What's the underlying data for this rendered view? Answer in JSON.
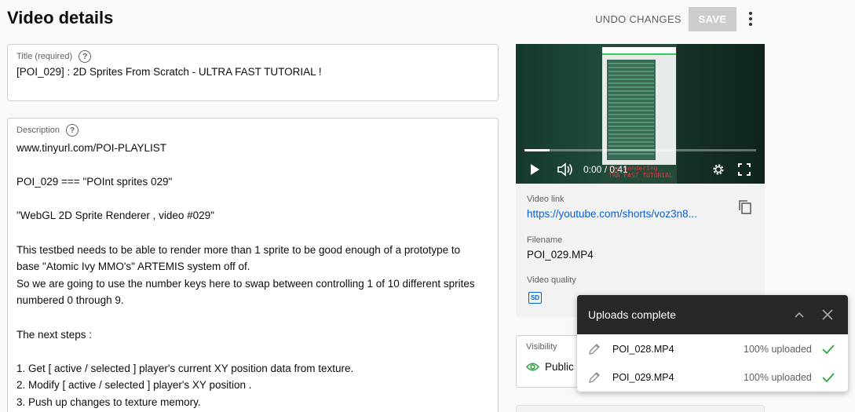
{
  "header": {
    "title": "Video details",
    "undo_label": "UNDO CHANGES",
    "save_label": "SAVE",
    "more_icon": "more-vert-icon"
  },
  "title_field": {
    "label": "Title (required)",
    "value": "[POI_029] : 2D Sprites From Scratch - ULTRA FAST TUTORIAL !"
  },
  "description_field": {
    "label": "Description",
    "lines": [
      "www.tinyurl.com/POI-PLAYLIST",
      "",
      "POI_029 === \"POInt sprites 029\"",
      "",
      "\"WebGL 2D Sprite Renderer , video #029\"",
      "",
      "This testbed needs to be able to render more than 1 sprite to be good enough of a prototype to",
      "base \"Atomic Ivy MMO's\" ARTEMIS system off of.",
      "So we are going to use the number keys here to swap between controlling 1 of 10 different sprites",
      "numbered 0 through 9.",
      "",
      "The next steps :",
      "",
      "1. Get [ active / selected ] player's current XY position data from texture.",
      "2. Modify [ active / selected ] player's XY position .",
      "3. Push up changes to texture memory."
    ]
  },
  "player": {
    "time": "0:00 / 0:41",
    "progress": 0.11,
    "overlay_text": "ite Rendering",
    "overlay_text2": "TRA FAST TUTORIAL"
  },
  "video_info": {
    "link_label": "Video link",
    "link": "https://youtube.com/shorts/voz3n8...",
    "filename_label": "Filename",
    "filename": "POI_029.MP4",
    "quality_label": "Video quality",
    "quality_badge": "SD"
  },
  "visibility": {
    "label": "Visibility",
    "value": "Public"
  },
  "uploads": {
    "title": "Uploads complete",
    "items": [
      {
        "name": "POI_028.MP4",
        "status": "100% uploaded"
      },
      {
        "name": "POI_029.MP4",
        "status": "100% uploaded"
      }
    ]
  },
  "colors": {
    "accent": "#065fd4",
    "success": "#2ba640",
    "toast_header": "#282828"
  }
}
